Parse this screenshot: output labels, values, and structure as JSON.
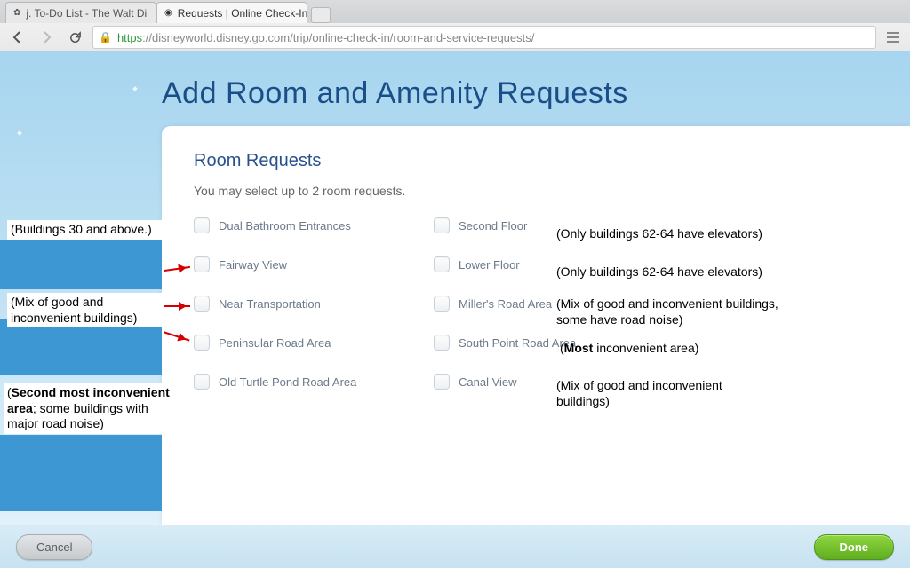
{
  "browser": {
    "tabs": [
      {
        "title": "j. To-Do List - The Walt Di",
        "active": false
      },
      {
        "title": "Requests | Online Check-In",
        "active": true
      }
    ],
    "url_secure": "https",
    "url_rest": "://disneyworld.disney.go.com/trip/online-check-in/room-and-service-requests/"
  },
  "page": {
    "title": "Add Room and Amenity Requests",
    "section_heading": "Room Requests",
    "subtext": "You may select up to 2 room requests.",
    "options_left": [
      "Dual Bathroom Entrances",
      "Fairway View",
      "Near Transportation",
      "Peninsular Road Area",
      "Old Turtle Pond Road Area"
    ],
    "options_right": [
      "Second Floor",
      "Lower Floor",
      "Miller's Road Area",
      "South Point Road Area",
      "Canal View"
    ],
    "cancel": "Cancel",
    "done": "Done"
  },
  "annotations": {
    "left": [
      "(Buildings 30 and above.)",
      "(Mix of good and inconvenient buildings)",
      "(Second most inconvenient area; some buildings with major road noise)"
    ],
    "right": [
      "(Only buildings 62-64 have elevators)",
      "(Only buildings 62-64 have elevators)",
      "(Mix of good and inconvenient buildings, some have road noise)",
      "(Most inconvenient area)",
      "(Mix of good and inconvenient buildings)"
    ]
  }
}
